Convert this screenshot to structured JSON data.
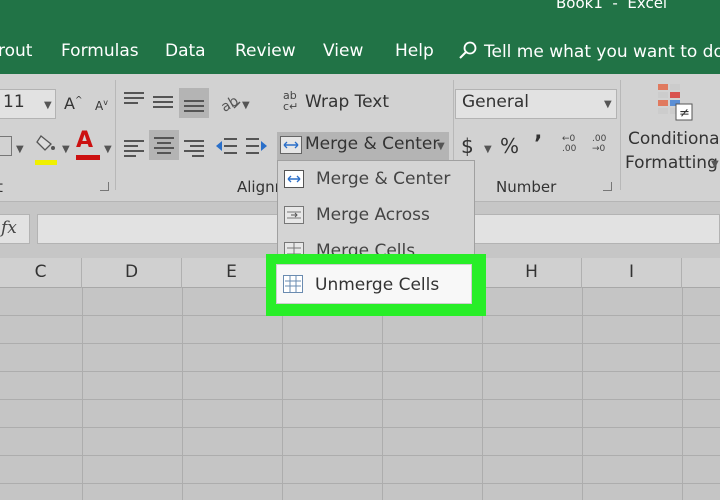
{
  "title_bar": {
    "title": "Book1  -  Excel"
  },
  "tabs": [
    "rout",
    "Formulas",
    "Data",
    "Review",
    "View",
    "Help"
  ],
  "tell_me": {
    "placeholder": "Tell me what you want to do"
  },
  "ribbon": {
    "font_size": "11",
    "wrap_text_label": "Wrap Text",
    "merge_center_label": "Merge & Center",
    "number_format": "General",
    "currency": "$",
    "percent": "%",
    "comma": "’",
    "conditional_formatting_line1": "Conditional",
    "conditional_formatting_line2": "Formatting",
    "group_alignment": "Alignm",
    "group_number": "Number",
    "group_font": "t"
  },
  "formula_bar": {
    "fx": "fx"
  },
  "columns": [
    "C",
    "D",
    "E",
    "F",
    "G",
    "H",
    "I"
  ],
  "dropdown": {
    "items": [
      "Merge & Center",
      "Merge Across",
      "Merge Cells",
      "Unmerge Cells"
    ]
  },
  "colors": {
    "excel_green": "#217346",
    "highlight": "#28ee28",
    "font_red": "#cc1111",
    "fill_yellow": "#f0f000"
  }
}
